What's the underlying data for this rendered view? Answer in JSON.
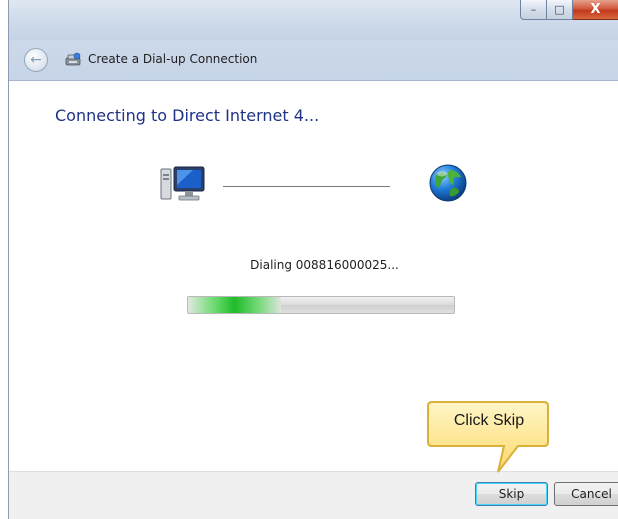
{
  "window": {
    "title": "Create a Dial-up Connection",
    "controls": {
      "minimize": "–",
      "maximize": "□",
      "close": "X"
    }
  },
  "nav": {
    "back_icon": "back-arrow-icon",
    "wizard_icon": "dialup-network-icon"
  },
  "main": {
    "heading": "Connecting to Direct Internet 4...",
    "source_icon": "computer-icon",
    "target_icon": "globe-icon",
    "status": "Dialing 008816000025...",
    "progress": 0.35
  },
  "footer": {
    "skip_label": "Skip",
    "cancel_label": "Cancel"
  },
  "callout": {
    "text": "Click Skip"
  },
  "colors": {
    "heading": "#1e3287",
    "progress": "#1fbb2a",
    "callout": "#fde9a0"
  }
}
